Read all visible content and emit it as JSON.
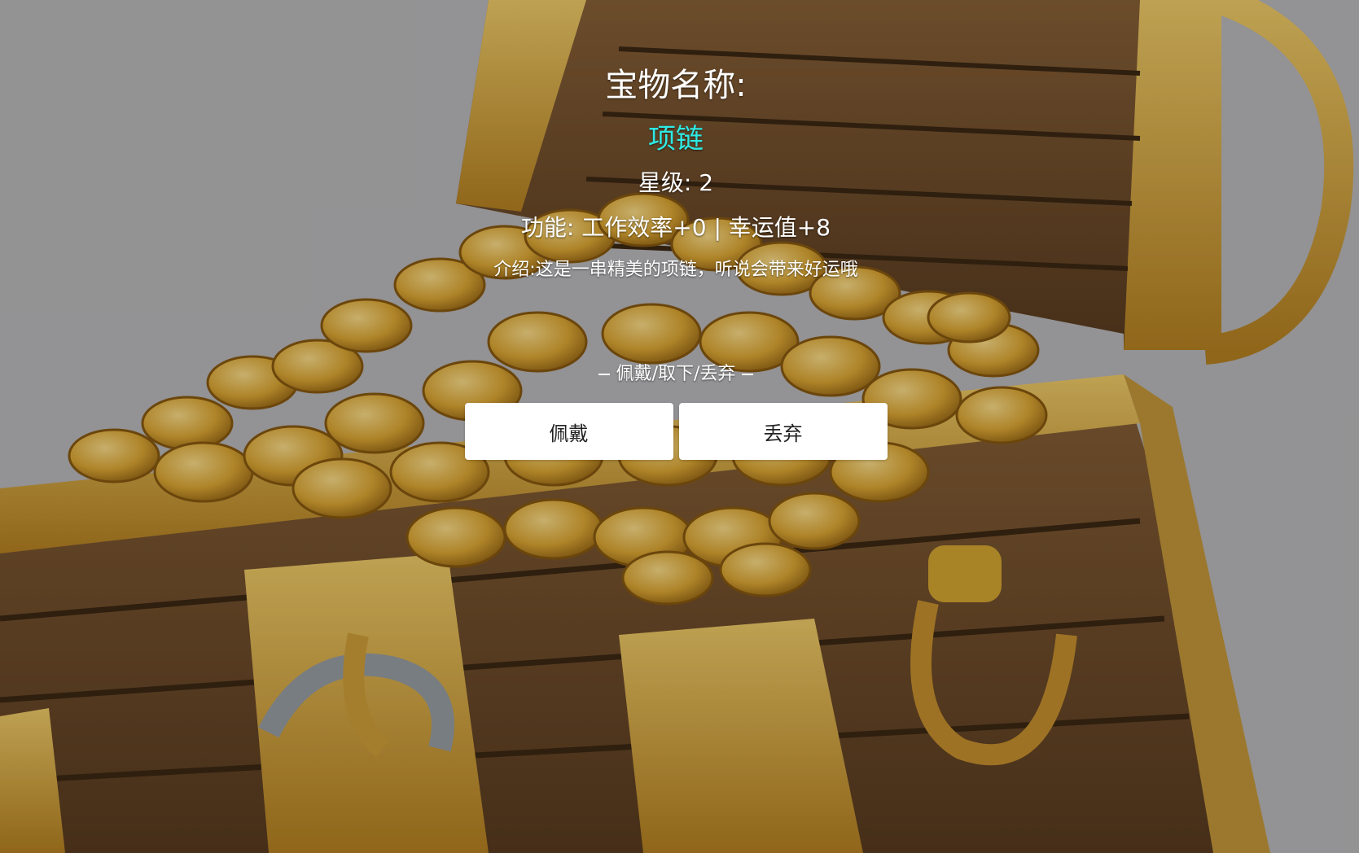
{
  "treasure": {
    "name_label": "宝物名称:",
    "name": "项链",
    "stars_label": "星级:",
    "stars": "2",
    "function_label": "功能:",
    "function_text": "工作效率+0 | 幸运值+8",
    "intro_label": "介绍:",
    "intro_text": "这是一串精美的项链，听说会带来好运哦"
  },
  "actions": {
    "divider_text": "佩戴/取下/丢弃",
    "wear_label": "佩戴",
    "discard_label": "丢弃"
  },
  "colors": {
    "accent_name": "#2ee9e4",
    "text": "#ffffff",
    "button_bg": "#ffffff",
    "gold": "#d9a933",
    "wood": "#6b4a2b"
  },
  "icons": {
    "background": "treasure-chest-illustration"
  }
}
